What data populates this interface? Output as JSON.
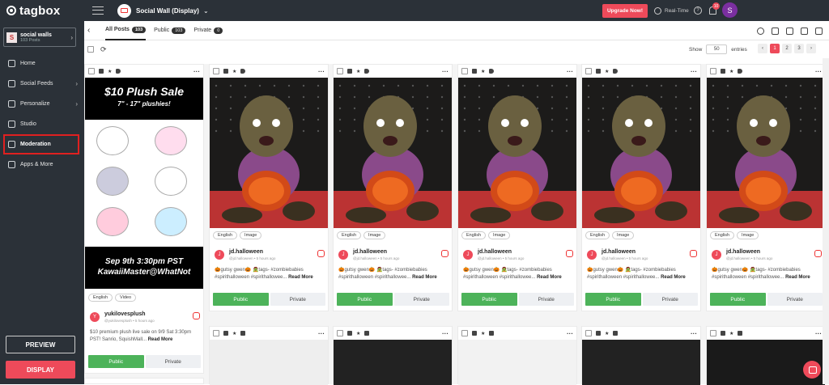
{
  "sidebar": {
    "logo": "tagbox",
    "account": {
      "initial": "S",
      "name": "social walls",
      "posts": "103 Posts"
    },
    "items": [
      {
        "label": "Home",
        "icon": "home-icon",
        "has_arrow": false
      },
      {
        "label": "Social Feeds",
        "icon": "feeds-icon",
        "has_arrow": true
      },
      {
        "label": "Personalize",
        "icon": "personalize-icon",
        "has_arrow": true
      },
      {
        "label": "Studio",
        "icon": "studio-icon",
        "has_arrow": false
      },
      {
        "label": "Moderation",
        "icon": "moderation-icon",
        "has_arrow": false,
        "active": true
      },
      {
        "label": "Apps & More",
        "icon": "apps-icon",
        "has_arrow": false
      }
    ],
    "preview_label": "PREVIEW",
    "display_label": "DISPLAY"
  },
  "topbar": {
    "wall_title": "Social Wall (Display)",
    "upgrade_label": "Upgrade Now!",
    "realtime_label": "Real-Time",
    "notif_count": "10",
    "user_initial": "S"
  },
  "tabs": [
    {
      "label": "All Posts",
      "count": "103",
      "active": true
    },
    {
      "label": "Public",
      "count": "103"
    },
    {
      "label": "Private",
      "count": "0"
    }
  ],
  "pagination": {
    "show_label": "Show",
    "entries_value": "50",
    "entries_label": "entries",
    "pages": [
      "1",
      "2",
      "3"
    ],
    "current": "1"
  },
  "cards": [
    {
      "type": "plush",
      "banner_top": "$10 Plush Sale",
      "banner_sub": "7\" - 17\" plushies!",
      "banner_bottom": "Sep 9th 3:30pm PST KawaiiMaster@WhatNot",
      "tags": [
        "English",
        "Video"
      ],
      "avatar": "Y",
      "user": "yukilovesplush",
      "meta": "@yukilovesplush • 5 hours ago",
      "text": "$10 premium plush live sale on 9/9 Sat 3:30pm PST! Sanrio, SquishMall...",
      "read_more": "Read More",
      "public_label": "Public",
      "private_label": "Private"
    },
    {
      "type": "photo",
      "tags": [
        "English",
        "Image"
      ],
      "avatar": "J",
      "user": "jd.halloween",
      "meta": "@jd.halloween • 5 hours ago",
      "text": "🎃gutsy gwen🎃 🧟tags- #zombiebabies #spirithalloween #spirithallowee...",
      "read_more": "Read More",
      "public_label": "Public",
      "private_label": "Private"
    },
    {
      "type": "photo",
      "tags": [
        "English",
        "Image"
      ],
      "avatar": "J",
      "user": "jd.halloween",
      "meta": "@jd.halloween • 5 hours ago",
      "text": "🎃gutsy gwen🎃 🧟tags- #zombiebabies #spirithalloween #spirithallowee...",
      "read_more": "Read More",
      "public_label": "Public",
      "private_label": "Private"
    },
    {
      "type": "photo",
      "tags": [
        "English",
        "Image"
      ],
      "avatar": "J",
      "user": "jd.halloween",
      "meta": "@jd.halloween • 5 hours ago",
      "text": "🎃gutsy gwen🎃 🧟tags- #zombiebabies #spirithalloween #spirithallowee...",
      "read_more": "Read More",
      "public_label": "Public",
      "private_label": "Private"
    },
    {
      "type": "photo",
      "tags": [
        "English",
        "Image"
      ],
      "avatar": "J",
      "user": "jd.halloween",
      "meta": "@jd.halloween • 5 hours ago",
      "text": "🎃gutsy gwen🎃 🧟tags- #zombiebabies #spirithalloween #spirithallowee...",
      "read_more": "Read More",
      "public_label": "Public",
      "private_label": "Private"
    },
    {
      "type": "photo",
      "tags": [
        "English",
        "Image"
      ],
      "avatar": "J",
      "user": "jd.halloween",
      "meta": "@jd.halloween • 5 hours ago",
      "text": "🎃gutsy gwen🎃 🧟tags- #zombiebabies #spirithalloween #spirithallowee...",
      "read_more": "Read More",
      "public_label": "Public",
      "private_label": "Private"
    }
  ],
  "colors": {
    "accent": "#ee4a5a",
    "sidebar": "#2b3138",
    "public_btn": "#4db35a"
  }
}
